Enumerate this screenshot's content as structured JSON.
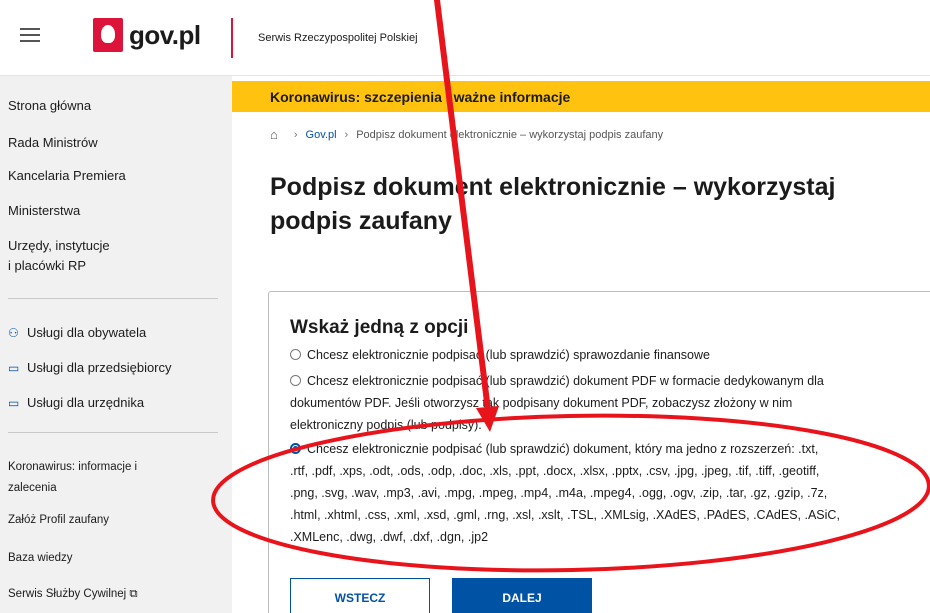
{
  "header": {
    "logo_text": "gov.pl",
    "service_name": "Serwis Rzeczypospolitej Polskiej"
  },
  "sidebar": {
    "main_links": [
      "Strona główna",
      "Rada Ministrów",
      "Kancelaria Premiera",
      "Ministerstwa",
      "Urzędy, instytucje",
      "i placówki RP"
    ],
    "service_links": [
      "Usługi dla obywatela",
      "Usługi dla przedsiębiorcy",
      "Usługi dla urzędnika"
    ],
    "info_links": [
      "Koronawirus: informacje i",
      "zalecenia",
      "Załóż Profil zaufany",
      "Baza wiedzy",
      "Serwis Służby Cywilnej ⧉"
    ]
  },
  "banner": {
    "text": "Koronawirus: szczepienia i ważne informacje"
  },
  "breadcrumb": {
    "home_icon": "home-icon",
    "items": [
      "Gov.pl",
      "Podpisz dokument elektronicznie – wykorzystaj podpis zaufany"
    ]
  },
  "page": {
    "title_line1": "Podpisz dokument elektronicznie – wykorzystaj",
    "title_line2": "podpis zaufany"
  },
  "form": {
    "title": "Wskaż jedną z opcji",
    "options": [
      {
        "lines": [
          "Chcesz elektronicznie podpisać (lub sprawdzić) sprawozdanie finansowe"
        ],
        "selected": false
      },
      {
        "lines": [
          "Chcesz elektronicznie podpisać (lub sprawdzić) dokument PDF w formacie dedykowanym dla",
          "dokumentów PDF. Jeśli otworzysz tak podpisany dokument PDF, zobaczysz złożony w nim",
          "elektroniczny podpis (lub podpisy)."
        ],
        "selected": false
      },
      {
        "lines": [
          "Chcesz elektronicznie podpisać (lub sprawdzić) dokument, który ma jedno z rozszerzeń: .txt,",
          ".rtf, .pdf, .xps, .odt, .ods, .odp, .doc, .xls, .ppt, .docx, .xlsx, .pptx, .csv, .jpg, .jpeg, .tif, .tiff, .geotiff,",
          ".png, .svg, .wav, .mp3, .avi, .mpg, .mpeg, .mp4, .m4a, .mpeg4, .ogg, .ogv, .zip, .tar, .gz, .gzip, .7z,",
          ".html, .xhtml, .css, .xml, .xsd, .gml, .rng, .xsl, .xslt, .TSL, .XMLsig, .XAdES, .PAdES, .CAdES, .ASiC,",
          ".XMLenc, .dwg, .dwf, .dxf, .dgn, .jp2"
        ],
        "selected": true
      }
    ]
  },
  "buttons": {
    "back": "WSTECZ",
    "next": "DALEJ"
  },
  "colors": {
    "accent_blue": "#0052a5",
    "banner_yellow": "#ffc20e",
    "brand_red": "#dc143c",
    "annotation_red": "#e8141c"
  }
}
